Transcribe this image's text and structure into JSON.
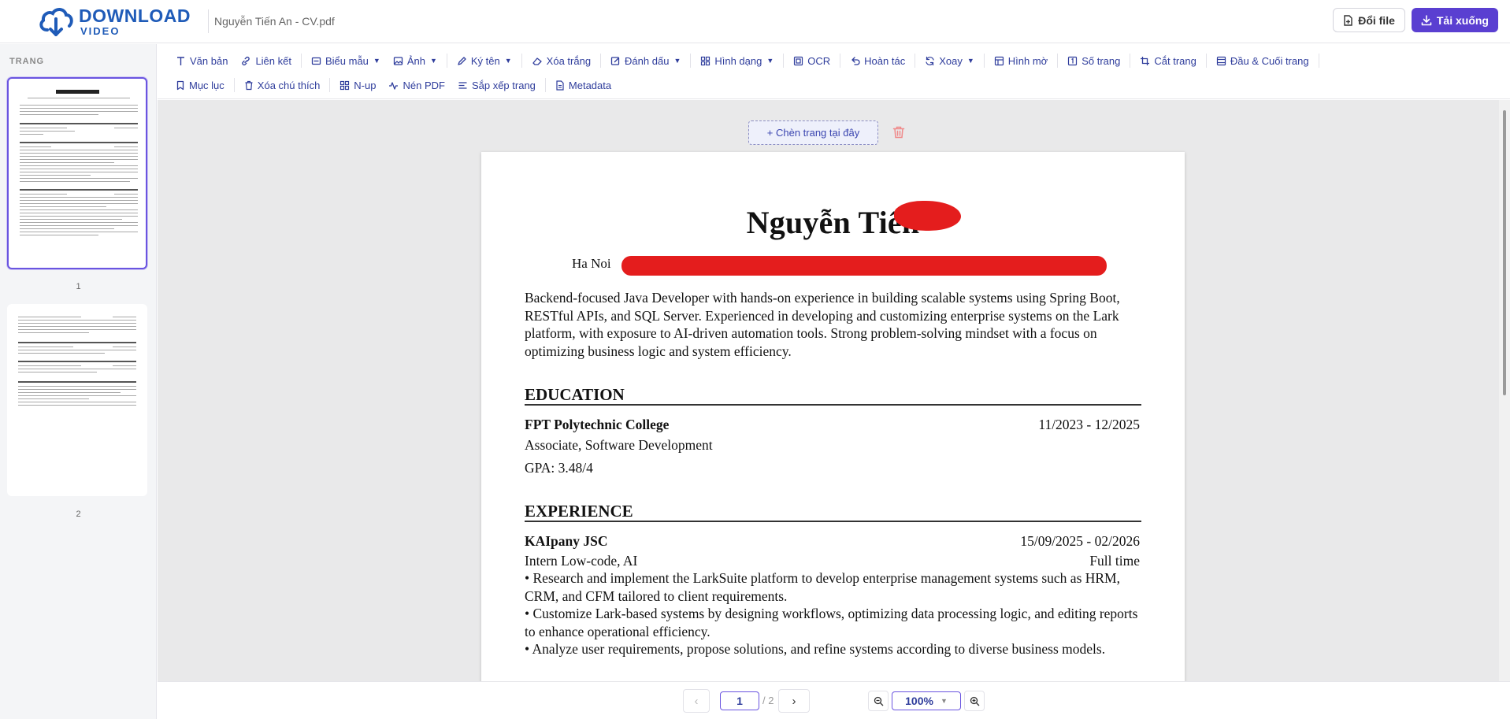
{
  "app": {
    "logo_line1": "DOWNLOAD",
    "logo_line2": "VIDEO",
    "file_name": "Nguyễn Tiến An - CV.pdf"
  },
  "header": {
    "convert_label": "Đổi file",
    "download_label": "Tải xuống"
  },
  "sidebar": {
    "title": "TRANG",
    "pages": [
      {
        "number": "1",
        "active": true
      },
      {
        "number": "2",
        "active": false
      }
    ]
  },
  "toolbar": {
    "row1": [
      {
        "label": "Văn bản",
        "icon": "text-icon"
      },
      {
        "label": "Liên kết",
        "icon": "link-icon"
      },
      {
        "label": "Biểu mẫu",
        "icon": "form-icon",
        "dropdown": true
      },
      {
        "label": "Ảnh",
        "icon": "image-icon",
        "dropdown": true
      },
      {
        "label": "Ký tên",
        "icon": "signature-icon",
        "dropdown": true
      },
      {
        "label": "Xóa trắng",
        "icon": "eraser-icon"
      },
      {
        "label": "Đánh dấu",
        "icon": "highlight-icon",
        "dropdown": true
      },
      {
        "label": "Hình dạng",
        "icon": "shapes-icon",
        "dropdown": true
      },
      {
        "label": "OCR",
        "icon": "ocr-icon"
      },
      {
        "label": "Hoàn tác",
        "icon": "undo-icon"
      },
      {
        "label": "Xoay",
        "icon": "rotate-icon",
        "dropdown": true
      },
      {
        "label": "Hình mờ",
        "icon": "watermark-icon"
      },
      {
        "label": "Số trang",
        "icon": "page-number-icon"
      },
      {
        "label": "Cắt trang",
        "icon": "crop-icon"
      },
      {
        "label": "Đầu & Cuối trang",
        "icon": "header-footer-icon"
      }
    ],
    "row2": [
      {
        "label": "Mục lục",
        "icon": "bookmark-icon"
      },
      {
        "label": "Xóa chú thích",
        "icon": "trash-icon"
      },
      {
        "label": "N-up",
        "icon": "grid-icon"
      },
      {
        "label": "Nén PDF",
        "icon": "compress-icon"
      },
      {
        "label": "Sắp xếp trang",
        "icon": "sort-icon"
      },
      {
        "label": "Metadata",
        "icon": "file-info-icon"
      }
    ]
  },
  "workspace": {
    "insert_page_label": "+ Chèn trang tại đây"
  },
  "document": {
    "name": "Nguyễn Tiến",
    "contact": "Ha Noi",
    "summary": "Backend-focused Java Developer with hands-on experience in building scalable systems using Spring Boot, RESTful APIs, and SQL Server. Experienced in developing and customizing enterprise systems on the Lark platform, with exposure to AI-driven automation tools. Strong problem-solving mindset with a focus on optimizing business logic and system efficiency.",
    "education": {
      "heading": "EDUCATION",
      "school": "FPT Polytechnic College",
      "dates": "11/2023 - 12/2025",
      "degree": "Associate, Software Development",
      "gpa": "GPA: 3.48/4"
    },
    "experience": {
      "heading": "EXPERIENCE",
      "company": "KAIpany JSC",
      "dates": "15/09/2025 - 02/2026",
      "role": "Intern Low-code, AI",
      "type": "Full time",
      "bullets": [
        "• Research and implement the LarkSuite platform to develop enterprise management systems such as HRM, CRM, and CFM tailored to client requirements.",
        "• Customize Lark-based systems by designing workflows, optimizing data processing logic, and editing reports to enhance operational efficiency.",
        "• Analyze user requirements, propose solutions, and refine systems according to diverse business models."
      ]
    }
  },
  "pagination": {
    "prev": "‹",
    "current_page": "1",
    "total": "/ 2",
    "next": "›"
  },
  "zoom": {
    "level": "100%"
  },
  "colors": {
    "accent": "#5a3fd1",
    "toolbar_text": "#2f3d9c",
    "logo": "#1f5bb8",
    "redaction": "#e41d1d"
  }
}
